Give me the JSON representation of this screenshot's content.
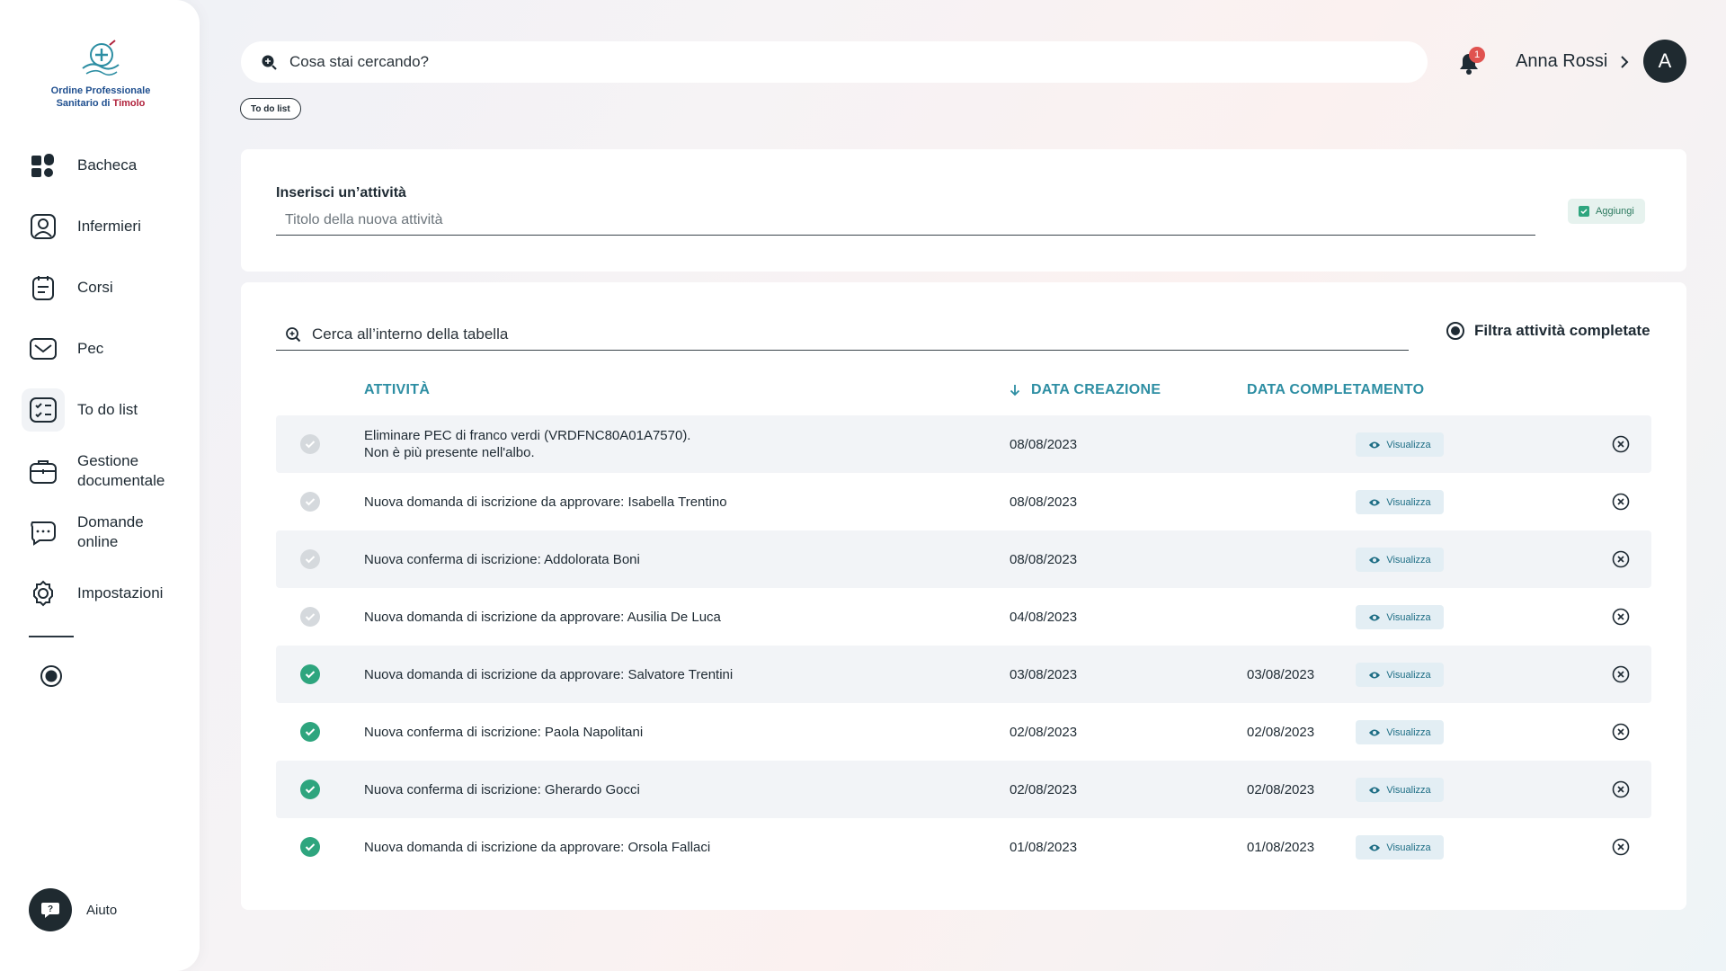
{
  "org": {
    "name_line1": "Ordine Professionale",
    "name_line2_a": "Sanitario di ",
    "name_line2_b": "Timolo"
  },
  "sidebar": {
    "items": [
      {
        "label": "Bacheca"
      },
      {
        "label": "Infermieri"
      },
      {
        "label": "Corsi"
      },
      {
        "label": "Pec"
      },
      {
        "label": "To do list"
      },
      {
        "label": "Gestione documentale"
      },
      {
        "label": "Domande online"
      },
      {
        "label": "Impostazioni"
      }
    ],
    "help_label": "Aiuto"
  },
  "header": {
    "search_placeholder": "Cosa stai cercando?",
    "notifications_count": "1",
    "user_name": "Anna Rossi",
    "avatar_initial": "A",
    "breadcrumb": "To do list"
  },
  "add_task": {
    "label": "Inserisci un’attività",
    "placeholder": "Titolo della nuova attività",
    "button_label": "Aggiungi"
  },
  "table": {
    "search_placeholder": "Cerca all’interno della tabella",
    "filter_label": "Filtra attività completate",
    "columns": {
      "activity": "ATTIVITÀ",
      "created": "DATA CREAZIONE",
      "completed": "DATA COMPLETAMENTO"
    },
    "view_label": "Visualizza",
    "rows": [
      {
        "line1": "Eliminare PEC di franco verdi (VRDFNC80A01A7570).",
        "line2": "Non è più presente nell'albo.",
        "created": "08/08/2023",
        "completed": "",
        "done": false
      },
      {
        "line1": "Nuova domanda di iscrizione da approvare: Isabella Trentino",
        "line2": "",
        "created": "08/08/2023",
        "completed": "",
        "done": false
      },
      {
        "line1": "Nuova conferma di iscrizione: Addolorata Boni",
        "line2": "",
        "created": "08/08/2023",
        "completed": "",
        "done": false
      },
      {
        "line1": "Nuova domanda di iscrizione da approvare: Ausilia De Luca",
        "line2": "",
        "created": "04/08/2023",
        "completed": "",
        "done": false
      },
      {
        "line1": "Nuova domanda di iscrizione da approvare: Salvatore Trentini",
        "line2": "",
        "created": "03/08/2023",
        "completed": "03/08/2023",
        "done": true
      },
      {
        "line1": "Nuova conferma di iscrizione: Paola Napolitani",
        "line2": "",
        "created": "02/08/2023",
        "completed": "02/08/2023",
        "done": true
      },
      {
        "line1": "Nuova conferma di iscrizione: Gherardo Gocci",
        "line2": "",
        "created": "02/08/2023",
        "completed": "02/08/2023",
        "done": true
      },
      {
        "line1": "Nuova domanda di iscrizione da approvare: Orsola Fallaci",
        "line2": "",
        "created": "01/08/2023",
        "completed": "01/08/2023",
        "done": true
      }
    ]
  },
  "colors": {
    "accent": "#2d8ea3",
    "done": "#2ea57e",
    "badge": "#e0524f",
    "dark": "#1f2a30"
  }
}
